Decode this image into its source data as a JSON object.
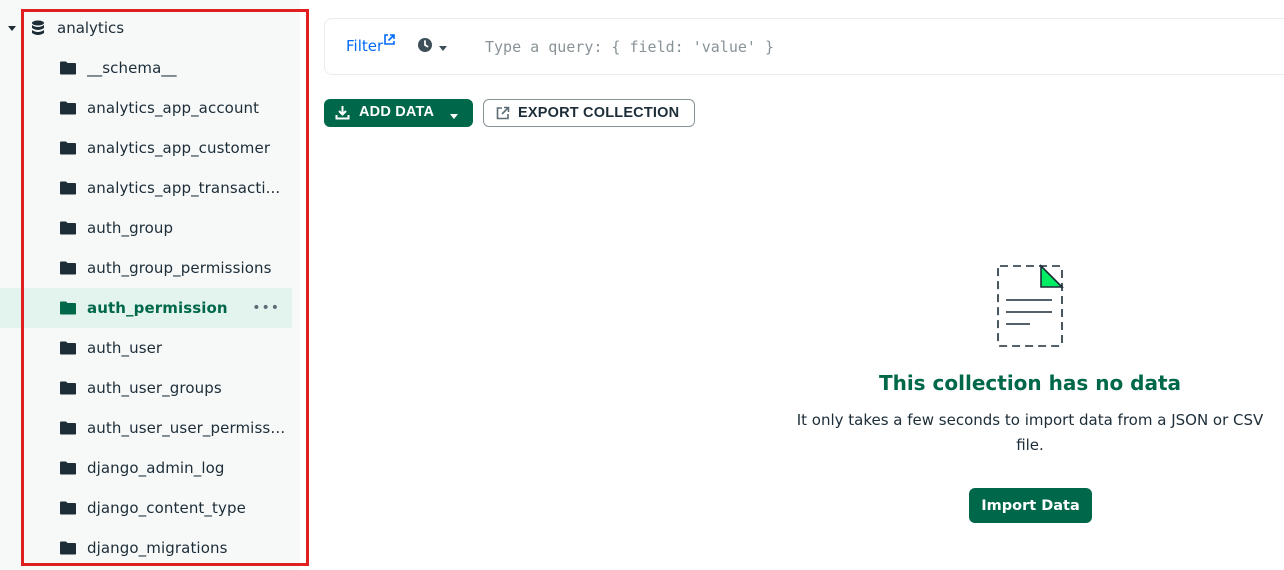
{
  "sidebar": {
    "database": {
      "name": "analytics"
    },
    "collections": [
      {
        "label": "__schema__"
      },
      {
        "label": "analytics_app_account"
      },
      {
        "label": "analytics_app_customer"
      },
      {
        "label": "analytics_app_transacti..."
      },
      {
        "label": "auth_group"
      },
      {
        "label": "auth_group_permissions"
      },
      {
        "label": "auth_permission",
        "active": true
      },
      {
        "label": "auth_user"
      },
      {
        "label": "auth_user_groups"
      },
      {
        "label": "auth_user_user_permissi..."
      },
      {
        "label": "django_admin_log"
      },
      {
        "label": "django_content_type"
      },
      {
        "label": "django_migrations"
      }
    ],
    "more_glyph": "•••"
  },
  "query_bar": {
    "filter_label": "Filter",
    "placeholder": "Type a query: { field: 'value' }",
    "value": ""
  },
  "toolbar": {
    "add_data_label": "ADD DATA",
    "export_label": "EXPORT COLLECTION"
  },
  "empty_state": {
    "title": "This collection has no data",
    "description": "It only takes a few seconds to import data from a JSON or CSV file.",
    "import_button": "Import Data"
  },
  "icons": {
    "database": "database-icon",
    "folder": "folder-icon",
    "caret": "caret-down-icon",
    "external": "external-link-icon",
    "history": "clock-icon",
    "download": "download-icon",
    "export": "export-icon",
    "document": "empty-document-icon"
  },
  "colors": {
    "accent": "#00684a",
    "link": "#016bf8",
    "active_bg": "#e3f4ef",
    "sidebar_bg": "#f7f9f9",
    "highlight_border": "#e02020",
    "illustration_green": "#00ed64"
  }
}
